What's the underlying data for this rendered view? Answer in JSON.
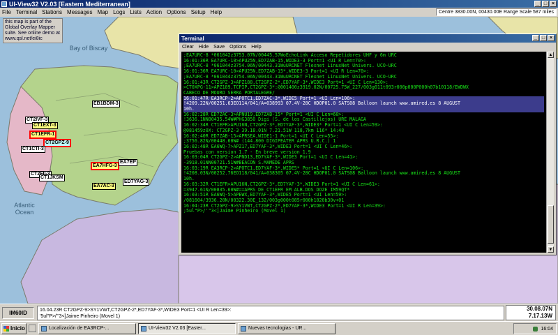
{
  "window": {
    "title": "UI-View32 V2.03 [Eastern Mediterranean]"
  },
  "menu": [
    "File",
    "Terminal",
    "Stations",
    "Messages",
    "Map",
    "Logs",
    "Lists",
    "Action",
    "Options",
    "Setup",
    "Help"
  ],
  "map_status": "Centre 3830.00N, 00430.00E Range Scale 587 miles",
  "overlay_note": "this map is part of the Global Overlay Mapper suite. See online demo at www.qsl.net/ei8ic",
  "sea_labels": {
    "biscay": "Bay of Biscay",
    "atlantic": "Atlantic Ocean"
  },
  "stations": [
    "EB1BDM-3",
    "CT2IVF-3",
    "CT1EXT-3",
    "CT1EFR-1",
    "CT2GPZ-9",
    "CT1CTI-3",
    "EA7HFG-3",
    "CT2FII-3",
    "CT1JKSM",
    "EA7AC-3",
    "ED7YAG-3",
    "EA7EP"
  ],
  "terminal": {
    "title": "Terminal",
    "menu": [
      "Clear",
      "Hide",
      "Save",
      "Options",
      "Help"
    ],
    "lines": [
      ";EA7URC-8 *061042z3753.07N/00445.57WoEchoLink Acceso Repetidores UHF y 6m URC",
      "16:01:36R EA7URC-10>APU25N,ED7ZAB-15,WIDE3-3 Port=1 <UI R Len=70>:",
      ";EA7URC-8 *061044z3754.06N/00443.31WuURCNET Flexnet LinuxNet Univers. UCO-URC",
      "16:01:36R EA7URC-10>APU25N,ED7ZAB-15*,WIDE3-3 Port=1 <UI R Len=70>:",
      ";EA7URC-8 *061044z3754.06N/00443.31WuURCNET Flexnet LinuxNet Univers. UCO-URC",
      "16:01:43R CT2GPZ-3>APZ188,CT2GPZ-2*,ED7YAF-3*,WIDE3 Port=1 <UI C Len=130>:",
      ">CT0XPG-11>APZ189,TCPIP,CT2GPZ-3*:@001400z3919.02N/00725.75W_227/003g011t093r000p000P000h07b10118/EWDWX",
      "CABECO DE MOURO SERRA PORTALEGRE/",
      "16:01:47R EA3RCP-2>APOTC1,ED7ZAC-3*,WIDE5 Port=1 <UI Len=106>:",
      "!4209.22N/00251.63EO114/041/A=038993 07.4V-28C HDOP01.0 SATS08 Balloon launch www.amired.es  8 AUGUST",
      "10h.",
      "16:02:28R ED7ZAC-3>APNU19,ED7ZAB-15* Port=1 <UI C Len=60>:",
      "!3636.1NN80435.54W#PHG3850 Digi (S. de los Castillejos) URE MALAGA",
      "16:02:34R CT1EFR>APU16N,CT2GPZ-3*,ED7YAF-3*,WIDE3* Port=1 <UI C Len=59>:",
      "@081459z0X: CT2GPZ-3 39.18.01N 7.21.51W 118,7km 116* 14:48",
      "16:02:40R ED7ZAB-15>APRSEA,WIDE1-1 Port=1 <UI C Len=55>:",
      ";3756.82N/00448.60W# (144.800 DIGIPEATER APRS U.R.C.) 1",
      "16:02:48R EA6WQ-7>APZ17,ED7YAF-3*,WIDE3 Port=1 <UI C Len=46>:",
      "Pruebas con version 1.7 - En breve version 1.9",
      "16:03:04R CT2GPZ-2>APND13,ED7YAF-3*,WIDE3 Port=1 <UI C Len=41>:",
      "-3918.01NN00721.51W#BEACON S.MAMEDE APRS",
      "16:03:19R EA3RCP-2>APOTC1,ED7YAF-3*,WIDE5* Port=1 <UI C Len=106>:",
      "!4208.03N/00252.76EO118/041/A=038305 07.4V-28C HDOP01.0 SATS08 Balloon launch www.amired.es  8 AUGUST",
      "10h.",
      "16:03:32R CT1EFR>APU16N,CT2GPZ-3*,ED7YAF-3*,WIDE3 Port=1 <UI C Len=61>:",
      "=3947.61N/00835.60W#==APRS DE CT1EFR EM ALB.DOS DOZE IM59QT*",
      "16:03:51R EA6WQ-5>APEWX,ED7YAF-3*,WIDE5 Port=1 <UI Len=59>:",
      "/081604/3936.20N/00322.30E_132/003g000t085r000h1020b30v+01",
      "16:04:23R CT2GPZ-9>SY1VWT,CT2GPZ-2*,ED7YAF-3*,WIDE3 Port=1 <UI R Len=39>:",
      ";5ul\"P>/'\"3<]Jaime Pinheiro (Movel 1)"
    ]
  },
  "bottom": {
    "locator": "IM60ID",
    "last_packet_1": "16.04.23R CT2GPZ-9>SY1VWT,CT2GPZ-2*,ED7YAF-3*,WIDE3 Port=1 <UI R Len=39>:",
    "last_packet_2": "'5ul\"P>/'\"3<]Jaime Pinheiro (Movel 1)",
    "lat": "30.08.07N",
    "lon": "7.17.13W"
  },
  "taskbar": {
    "start": "Inicio",
    "tasks": [
      "Localización de EA3RCP-...",
      "UI-View32 V2.03 [Easter...",
      "Nuevas tecnologias - UR..."
    ],
    "clock": "16:04"
  }
}
